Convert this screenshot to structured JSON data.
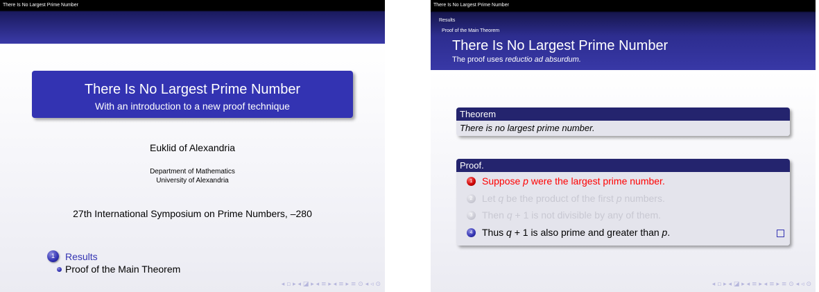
{
  "left_slide": {
    "header_text": "There Is No Largest Prime Number",
    "title": "There Is No Largest Prime Number",
    "subtitle": "With an introduction to a new proof technique",
    "author": "Euklid of Alexandria",
    "institute_line1": "Department of Mathematics",
    "institute_line2": "University of Alexandria",
    "date": "27th International Symposium on Prime Numbers, –280",
    "toc": {
      "section_number": "1",
      "section": "Results",
      "subsection": "Proof of the Main Theorem"
    },
    "nav_symbols": "◂ ▫ ▸ ◂ ◪ ▸ ◂ ≡ ▸ ◂ ≡ ▸ ≡ ⊙ ◂ ◃ ⊙"
  },
  "right_slide": {
    "nav_title": "There Is No Largest Prime Number",
    "nav_section": "Results",
    "nav_subsection": "Proof of the Main Theorem",
    "frame_title": "There Is No Largest Prime Number",
    "frame_subtitle_prefix": "The proof uses ",
    "frame_subtitle_emph": "reductio ad absurdum.",
    "theorem": {
      "heading": "Theorem",
      "statement": "There is no largest prime number."
    },
    "proof": {
      "heading": "Proof.",
      "items": [
        {
          "number": "1",
          "state": "active"
        },
        {
          "number": "2",
          "state": "inactive"
        },
        {
          "number": "3",
          "state": "inactive"
        },
        {
          "number": "4",
          "state": "current"
        }
      ],
      "item1": {
        "a": "Suppose ",
        "b": "p",
        "c": " were the largest prime number."
      },
      "item2": {
        "a": "Let ",
        "b": "q",
        "c": " be the product of the first ",
        "d": "p",
        "e": " numbers."
      },
      "item3": {
        "a": "Then ",
        "b": "q",
        "c": " + 1 is not divisible by any of them."
      },
      "item4": {
        "a": "Thus ",
        "b": "q",
        "c": " + 1 is also prime and greater than ",
        "d": "p",
        "e": "."
      }
    },
    "nav_symbols": "◂ ▫ ▸ ◂ ◪ ▸ ◂ ≡ ▸ ◂ ≡ ▸ ≡ ⊙ ◂ ◃ ⊙"
  },
  "colors": {
    "beamer_blue": "#3333b2",
    "block_header": "#24246e",
    "block_body": "#e4e4ec",
    "alert_red": "#ff0000",
    "inactive_grey": "#c8c8d2"
  }
}
